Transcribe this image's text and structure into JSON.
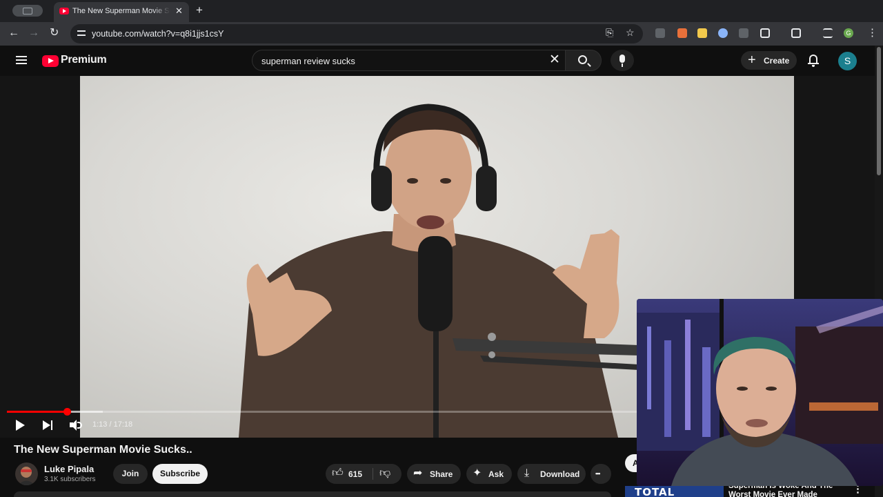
{
  "browser": {
    "tab_title": "The New Superman Movie Sucks..",
    "tab_close": "✕",
    "new_tab": "+",
    "url": "youtube.com/watch?v=q8i1jjs1csY",
    "back": "←",
    "forward": "→",
    "reload": "↻",
    "install_icon": "⎘",
    "star_icon": "☆",
    "menu_dots": "⋮",
    "profile_initial": "G"
  },
  "header": {
    "logo_text": "Premium",
    "search_value": "superman review sucks",
    "clear": "✕",
    "create_plus": "+",
    "create_label": "Create",
    "avatar_initial": "S"
  },
  "player": {
    "time_display": "1:13 / 17:18",
    "progress_played_fraction": 0.07,
    "progress_buffered_fraction": 0.111
  },
  "video": {
    "title": "The New Superman Movie Sucks..",
    "channel_name": "Luke Pipala",
    "subscribers": "3.1K subscribers",
    "join_label": "Join",
    "subscribe_label": "Subscribe",
    "like_count": "615",
    "share_label": "Share",
    "ask_label": "Ask",
    "download_label": "Download",
    "more": "•••"
  },
  "sidebar": {
    "partial_button": "A",
    "rec_title": "Superman Is Woke And The Worst Movie Ever Made",
    "rec_thumb_text": "TOTAL",
    "rec_more": "⋮"
  },
  "colors": {
    "accent": "#ff0000",
    "brand": "#ff0033",
    "background": "#0f0f0f"
  }
}
